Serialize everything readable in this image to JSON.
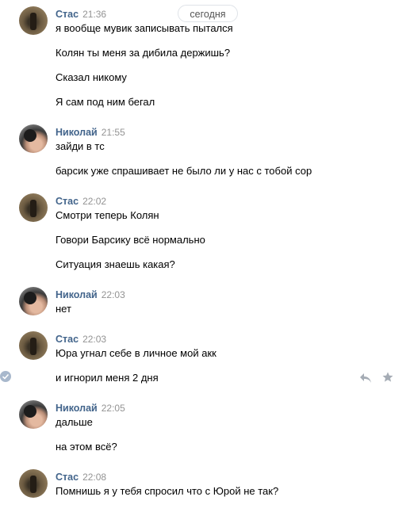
{
  "date_pill": "сегодня",
  "groups": [
    {
      "author": "Стас",
      "time": "21:36",
      "avatar": "stas-avatar",
      "lines": [
        "я вообще мувик записывать пытался",
        "Колян ты меня за дибила держишь?",
        "Сказал никому",
        "Я сам под ним бегал"
      ]
    },
    {
      "author": "Николай",
      "time": "21:55",
      "avatar": "nikolay-avatar",
      "lines": [
        "зайди в тс",
        "барсик уже спрашивает не было ли у нас с тобой сор"
      ]
    },
    {
      "author": "Стас",
      "time": "22:02",
      "avatar": "stas-avatar",
      "lines": [
        "Смотри теперь Колян",
        "Говори Барсику всё нормально",
        "Ситуация знаешь какая?"
      ]
    },
    {
      "author": "Николай",
      "time": "22:03",
      "avatar": "nikolay-avatar",
      "lines": [
        "нет"
      ]
    },
    {
      "author": "Стас",
      "time": "22:03",
      "avatar": "stas-avatar",
      "lines": [
        "Юра угнал себе в личное мой акк",
        "и игнорил меня 2 дня"
      ]
    },
    {
      "author": "Николай",
      "time": "22:05",
      "avatar": "nikolay-avatar",
      "lines": [
        "дальше",
        "на этом всё?"
      ]
    },
    {
      "author": "Стас",
      "time": "22:08",
      "avatar": "stas-avatar",
      "lines": [
        "Помнишь я у тебя спросил что с Юрой не так?"
      ]
    }
  ],
  "icons": {
    "selected": "check-circle-icon",
    "reply": "reply-icon",
    "favorite": "star-icon"
  },
  "colors": {
    "author": "#42648b",
    "time": "#939393",
    "pill_border": "#dfe3e8"
  }
}
